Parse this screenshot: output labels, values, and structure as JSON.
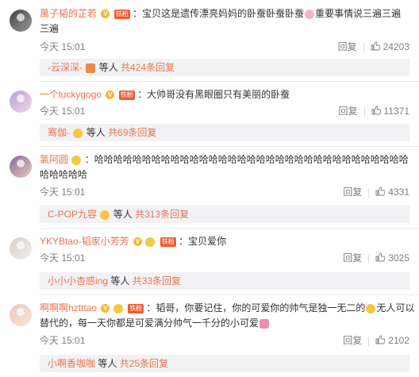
{
  "reply_label": "回复",
  "comments": [
    {
      "user": "萬子韬的芷若",
      "text": "宝贝这是遗传漂亮妈妈的卧蚕卧蚕卧蚕",
      "text2": "重要事情说三遍三遍",
      "text3": "三遍",
      "time": "今天 15:01",
      "likes": "24203",
      "replies_user": "-云深深-",
      "replies_mid": "等人",
      "replies_count": "共424条回复"
    },
    {
      "user": "一个luckygogo",
      "text": "大帅哥没有黑眼圈只有美丽的卧蚕",
      "time": "今天 15:01",
      "likes": "11371",
      "replies_user": "骞伽-",
      "replies_mid": "等人",
      "replies_count": "共69条回复"
    },
    {
      "user": "氯阿圆",
      "text": "哈哈哈哈哈哈哈哈哈哈哈哈哈哈哈哈哈哈哈哈哈哈哈哈哈哈哈哈哈哈哈哈哈",
      "text2": "哈哈哈哈哈",
      "time": "今天 15:01",
      "likes": "4331",
      "replies_user": "C-POP九容",
      "replies_mid": "等人",
      "replies_count": "共313条回复"
    },
    {
      "user": "YKYBtao-韬家小芳芳",
      "text": "宝贝爱你",
      "time": "今天 15:01",
      "likes": "3025",
      "replies_user": "小小小杏感ing",
      "replies_mid": "等人",
      "replies_count": "共33条回复"
    },
    {
      "user": "啊啊啊hztttao",
      "text": "韬哥，你要记住，你的可爱你的帅气是独一无二的",
      "text_b": "无人可以",
      "text2": "替代的，每一天你都是可爱满分帅气一千分的小可爱",
      "time": "今天 15:01",
      "likes": "2102",
      "replies_user": "小啊香咖咖",
      "replies_mid": "等人",
      "replies_count": "共25条回复"
    }
  ],
  "badges": {
    "fan": "铁粉",
    "v": "V"
  },
  "colors": {
    "username": "#eb7350",
    "meta": "#808080",
    "reply_bg": "#f2f2f5"
  },
  "icons": {
    "like": "thumbs-up-icon",
    "vip": "vip-badge-icon",
    "fan": "fan-badge-icon"
  }
}
